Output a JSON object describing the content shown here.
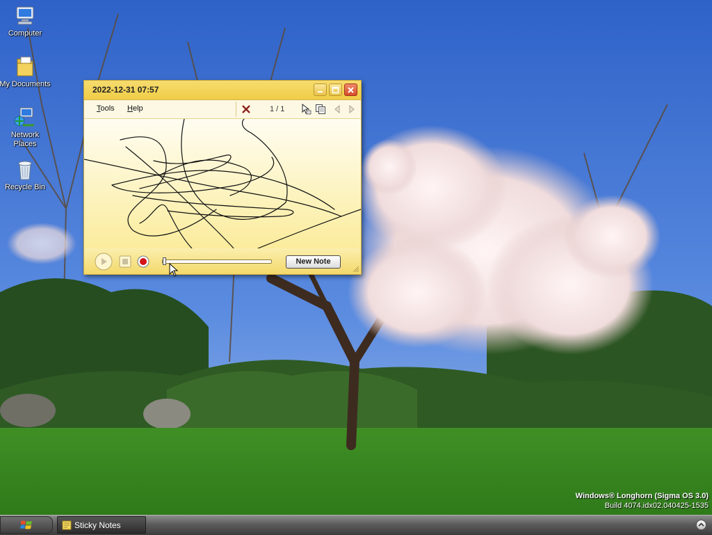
{
  "desktop": {
    "icons": [
      {
        "label": "Computer",
        "icon": "computer-icon"
      },
      {
        "label": "My Documents",
        "icon": "documents-folder-icon"
      },
      {
        "label": "Network Places",
        "icon": "network-places-icon"
      },
      {
        "label": "Recycle Bin",
        "icon": "recycle-bin-icon"
      }
    ]
  },
  "sticky_note": {
    "title": "2022-12-31 07:57",
    "menu": [
      {
        "label": "Tools",
        "accel": "T",
        "rest": "ools"
      },
      {
        "label": "Help",
        "accel": "H",
        "rest": "elp"
      }
    ],
    "toolbar_icons": [
      "delete-note-icon",
      "pointer-icon",
      "copy-icon",
      "previous-note-icon",
      "next-note-icon"
    ],
    "page_counter": "1 / 1",
    "new_note_label": "New Note",
    "playback_position": 0
  },
  "watermark": {
    "line1": "Windows® Longhorn (Sigma OS 3.0)",
    "line2": "Build 4074.idx02.040425-1535"
  },
  "taskbar": {
    "start_icon": "windows-logo-icon",
    "items": [
      {
        "label": "Sticky Notes",
        "icon": "sticky-notes-icon"
      }
    ],
    "tray_icon": "show-more-chevron-icon"
  },
  "colors": {
    "note_background": "#fbeea0",
    "sky": "#3a6fd0",
    "grass": "#4a9a2c"
  }
}
